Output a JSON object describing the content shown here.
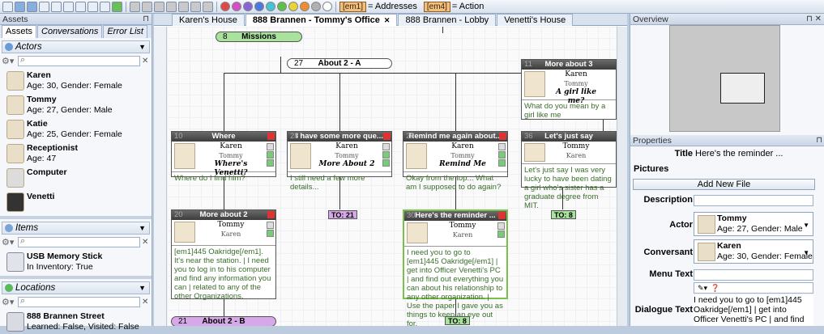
{
  "toolbar": {
    "em1": "[em1]",
    "em1_label": "= Addresses",
    "em4": "[em4]",
    "em4_label": "= Action"
  },
  "left": {
    "title": "Assets",
    "tabs": [
      "Assets",
      "Conversations",
      "Error List"
    ],
    "actors_header": "Actors",
    "actors": [
      {
        "name": "Karen",
        "detail": "Age: 30, Gender: Female"
      },
      {
        "name": "Tommy",
        "detail": "Age: 27, Gender: Male"
      },
      {
        "name": "Katie",
        "detail": "Age: 25, Gender: Female"
      },
      {
        "name": "Receptionist",
        "detail": "Age: 47"
      },
      {
        "name": "Computer",
        "detail": ""
      },
      {
        "name": "Venetti",
        "detail": ""
      }
    ],
    "items_header": "Items",
    "items": [
      {
        "name": "USB Memory Stick",
        "detail": "In Inventory: True"
      }
    ],
    "locations_header": "Locations",
    "locations": [
      {
        "name": "888 Brannen Street",
        "detail": "Learned: False, Visited: False"
      }
    ]
  },
  "center": {
    "tabs": [
      "Karen's House",
      "888 Brannen - Tommy's Office",
      "888 Brannen - Lobby",
      "Venetti's House"
    ],
    "pills": [
      {
        "id": "8",
        "label": "Missions"
      },
      {
        "id": "27",
        "label": "About 2 - A"
      },
      {
        "id": "21",
        "label": "About 2 - B"
      }
    ],
    "nodes": [
      {
        "id": "11",
        "title": "More about 3",
        "actor": "Karen",
        "conv": "Tommy",
        "menu": "A girl like me?",
        "text": "What do you mean by a girl like me"
      },
      {
        "id": "10",
        "title": "Where",
        "actor": "Karen",
        "conv": "Tommy",
        "menu": "Where's Venetti?",
        "text": "Where do I find him?"
      },
      {
        "id": "28",
        "title": "I have some more que...",
        "actor": "Karen",
        "conv": "Tommy",
        "menu": "More About 2",
        "text": "I still need a few more details..."
      },
      {
        "id": "29",
        "title": "Remind me again about...",
        "actor": "Karen",
        "conv": "Tommy",
        "menu": "Remind Me",
        "text": "Okay from the top... What am I supposed to do again?"
      },
      {
        "id": "36",
        "title": "Let's just say",
        "actor": "Tommy",
        "conv": "Karen",
        "menu": "",
        "text": "Let's just say I was very lucky to have been dating a girl who's sister has a graduate degree from MIT."
      },
      {
        "id": "20",
        "title": "More about 2",
        "actor": "Tommy",
        "conv": "Karen",
        "menu": "",
        "text": "[em1]445 Oakridge[/em1]. It's near the station. | I need you to log in to his computer and find any information you can | related to any of the other Organizations."
      },
      {
        "id": "30",
        "title": "Here's the reminder ...",
        "actor": "Tommy",
        "conv": "Karen",
        "menu": "",
        "text": "I need you to go to [em1]445 Oakridge[/em1] | get into Officer Venetti's PC | and find out everything you can about his relationship to any other organization. | Use the paper I gave you as things to keep an eye out for."
      }
    ],
    "to": [
      "TO: 21",
      "TO: 8",
      "TO: 8"
    ]
  },
  "right": {
    "overview_title": "Overview",
    "props_title": "Properties",
    "title_label": "Title",
    "title_value": "Here's the reminder ...",
    "pictures_label": "Pictures",
    "add_file": "Add New File",
    "desc_label": "Description",
    "actor_label": "Actor",
    "actor_name": "Tommy",
    "actor_detail": "Age: 27, Gender: Male",
    "conv_label": "Conversant",
    "conv_name": "Karen",
    "conv_detail": "Age: 30, Gender: Female",
    "menu_label": "Menu Text",
    "dialogue_label": "Dialogue Text",
    "dialogue_value": "I need you to go to [em1]445 Oakridge[/em1] | get into Officer Venetti's PC | and find out"
  }
}
